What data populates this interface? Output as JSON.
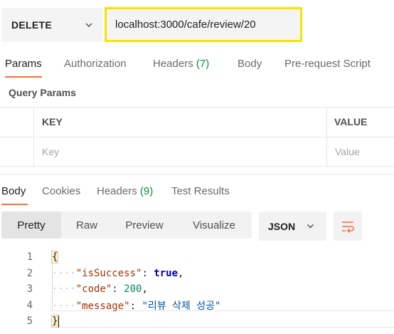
{
  "request": {
    "method": "DELETE",
    "url": "localhost:3000/cafe/review/20"
  },
  "request_tabs": [
    {
      "label": "Params",
      "count": ""
    },
    {
      "label": "Authorization",
      "count": ""
    },
    {
      "label": "Headers ",
      "count": "(7)"
    },
    {
      "label": "Body",
      "count": ""
    },
    {
      "label": "Pre-request Script",
      "count": ""
    }
  ],
  "query_params": {
    "title": "Query Params",
    "columns": [
      "KEY",
      "VALUE"
    ],
    "placeholders": [
      "Key",
      "Value"
    ]
  },
  "response_tabs": [
    {
      "label": "Body",
      "count": ""
    },
    {
      "label": "Cookies",
      "count": ""
    },
    {
      "label": "Headers ",
      "count": "(9)"
    },
    {
      "label": "Test Results",
      "count": ""
    }
  ],
  "format": {
    "views": [
      "Pretty",
      "Raw",
      "Preview",
      "Visualize"
    ],
    "active_view": "Pretty",
    "language": "JSON"
  },
  "response_body": {
    "line_numbers": [
      "1",
      "2",
      "3",
      "4",
      "5"
    ],
    "open_brace": "{",
    "close_brace": "}",
    "fields": [
      {
        "key": "\"isSuccess\"",
        "value": "true",
        "type": "bool"
      },
      {
        "key": "\"code\"",
        "value": "200",
        "type": "num"
      },
      {
        "key": "\"message\"",
        "value": "\"리뷰 삭제 성공\"",
        "type": "str"
      }
    ]
  },
  "colors": {
    "accent": "#ff6c37",
    "highlight_border": "#f5e400",
    "count_green": "#0f8a3d"
  }
}
